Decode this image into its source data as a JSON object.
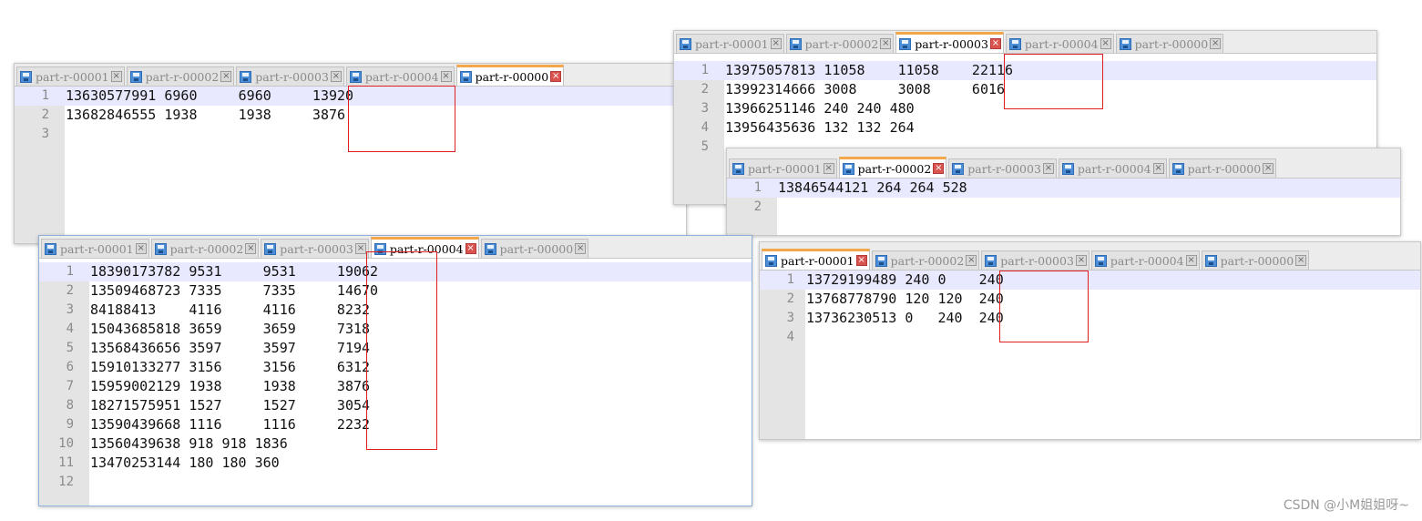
{
  "windows": [
    {
      "id": "w1",
      "tabs": [
        "part-r-00001",
        "part-r-00002",
        "part-r-00003",
        "part-r-00004",
        "part-r-00000"
      ],
      "active_tab": 4,
      "lines": [
        "13630577991 6960     6960     13920",
        "13682846555 1938     1938     3876",
        ""
      ]
    },
    {
      "id": "w2",
      "tabs": [
        "part-r-00001",
        "part-r-00002",
        "part-r-00003",
        "part-r-00004",
        "part-r-00000"
      ],
      "active_tab": 2,
      "lines": [
        "13975057813 11058    11058    22116",
        "13992314666 3008     3008     6016",
        "13966251146 240 240 480",
        "13956435636 132 132 264",
        ""
      ]
    },
    {
      "id": "w3",
      "tabs": [
        "part-r-00001",
        "part-r-00002",
        "part-r-00003",
        "part-r-00004",
        "part-r-00000"
      ],
      "active_tab": 1,
      "lines": [
        "13846544121 264 264 528",
        ""
      ]
    },
    {
      "id": "w4",
      "tabs": [
        "part-r-00001",
        "part-r-00002",
        "part-r-00003",
        "part-r-00004",
        "part-r-00000"
      ],
      "active_tab": 3,
      "lines": [
        "18390173782 9531     9531     19062",
        "13509468723 7335     7335     14670",
        "84188413    4116     4116     8232",
        "15043685818 3659     3659     7318",
        "13568436656 3597     3597     7194",
        "15910133277 3156     3156     6312",
        "15959002129 1938     1938     3876",
        "18271575951 1527     1527     3054",
        "13590439668 1116     1116     2232",
        "13560439638 918 918 1836",
        "13470253144 180 180 360",
        ""
      ]
    },
    {
      "id": "w5",
      "tabs": [
        "part-r-00001",
        "part-r-00002",
        "part-r-00003",
        "part-r-00004",
        "part-r-00000"
      ],
      "active_tab": 0,
      "lines": [
        "13729199489 240 0    240",
        "13768778790 120 120  240",
        "13736230513 0   240  240",
        ""
      ]
    }
  ],
  "watermark": "CSDN @小M姐姐呀~",
  "colors": {
    "active_tab_accent": "#f3a64a",
    "highlight_box": "#e02020",
    "current_line": "#e8e8ff"
  },
  "icons": {
    "tab_file": "floppy-disk-icon",
    "tab_close": "close-icon"
  }
}
